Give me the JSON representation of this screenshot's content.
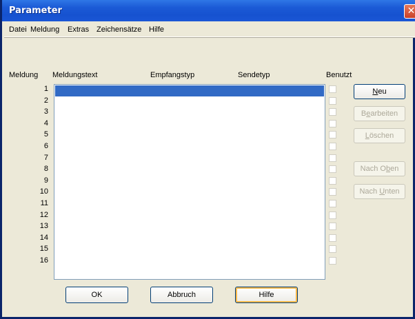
{
  "window": {
    "title": "Parameter"
  },
  "menu": [
    "Datei",
    "Meldung",
    "Extras",
    "Zeichensätze",
    "Hilfe"
  ],
  "columns": {
    "meldung": "Meldung",
    "text": "Meldungstext",
    "empfang": "Empfangstyp",
    "sende": "Sendetyp",
    "benutzt": "Benutzt"
  },
  "rows": [
    "1",
    "2",
    "3",
    "4",
    "5",
    "6",
    "7",
    "8",
    "9",
    "10",
    "11",
    "12",
    "13",
    "14",
    "15",
    "16"
  ],
  "selected_row": 1,
  "side_buttons": {
    "neu": {
      "pre": "",
      "acc": "N",
      "post": "eu"
    },
    "bearbeiten": {
      "pre": "B",
      "acc": "e",
      "post": "arbeiten"
    },
    "loeschen": {
      "pre": "",
      "acc": "L",
      "post": "öschen"
    },
    "nach_oben": {
      "pre": "Nach O",
      "acc": "b",
      "post": "en"
    },
    "nach_unten": {
      "pre": "Nach ",
      "acc": "U",
      "post": "nten"
    }
  },
  "bottom_buttons": {
    "ok": "OK",
    "cancel": "Abbruch",
    "help": "Hilfe"
  },
  "colors": {
    "selection": "#316AC5",
    "title_bar": "#1652D0",
    "dialog_bg": "#ECE9D8"
  }
}
